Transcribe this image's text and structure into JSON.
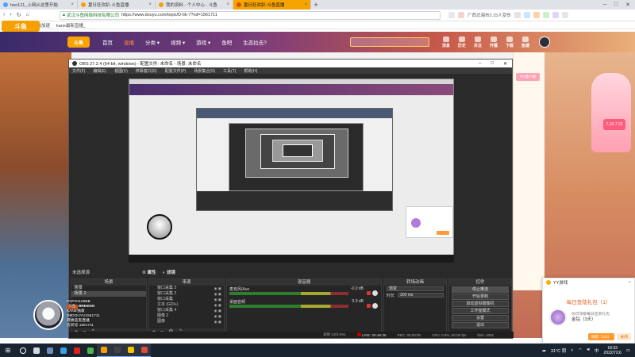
{
  "browser": {
    "tabs": [
      {
        "title": "heo121_上网从这里开始",
        "color": "#4aa0ff",
        "active": false
      },
      {
        "title": "夏日狂欢趴-斗鱼直播",
        "color": "#f5a000",
        "active": false
      },
      {
        "title": "我的资料 - 个人中心 - 斗鱼",
        "color": "#f5a000",
        "active": false
      },
      {
        "title": "夏日狂欢趴-斗鱼直播",
        "color": "#f5a000",
        "active": true
      }
    ],
    "url_site": "武汉斗鱼网络科技有限公司",
    "url": "https://www.douyu.com/topic/D-tik-7?rid=1561711",
    "addr_right_text": "广西北海市2.15人受伤",
    "bookmarks": [
      "谷歌游戏加速",
      "kane最新直播_"
    ],
    "logo_text": "斗鱼"
  },
  "site": {
    "logo": "斗鱼",
    "nav": [
      {
        "label": "首页",
        "on": false
      },
      {
        "label": "直播",
        "on": true
      },
      {
        "label": "分类 ▾",
        "on": false
      },
      {
        "label": "视频 ▾",
        "on": false
      },
      {
        "label": "游戏 ▾",
        "on": false
      },
      {
        "label": "鱼吧",
        "on": false
      },
      {
        "label": "生态拉击?",
        "on": false
      }
    ],
    "tools": [
      "消息",
      "历史",
      "关注",
      "开播",
      "下载",
      "鱼塘"
    ],
    "pink_badge": "PC客户端",
    "ad_label": "7.16-7.22"
  },
  "obs": {
    "title": "OBS 27.2.4 (64-bit, windows) - 配置文件: 未命名 - 场景: 未命名",
    "menu": [
      "文件(F)",
      "编辑(E)",
      "视图(V)",
      "停靠窗口(D)",
      "配置文件(P)",
      "场景集合(S)",
      "工具(T)",
      "帮助(H)"
    ],
    "no_source_selected": "未选择源",
    "props_label": "属性",
    "filters_label": "滤镜",
    "docks": {
      "scenes": {
        "title": "场景",
        "items": [
          "场景",
          "场景 2"
        ]
      },
      "sources": {
        "title": "来源",
        "items": [
          "窗口采集 3",
          "窗口采集 2",
          "窗口采集",
          "文本 (GDI+)",
          "窗口采集 4",
          "图像 2",
          "图像"
        ]
      },
      "mixer": {
        "title": "混音器",
        "channels": [
          {
            "name": "麦克风/Aux",
            "db": "-0.0 dB"
          },
          {
            "name": "桌面音频",
            "db": "0.0 dB"
          }
        ]
      },
      "transitions": {
        "title": "转场动画",
        "type": "渐变",
        "duration_label": "时长",
        "duration": "300 ms"
      },
      "controls": {
        "title": "控件",
        "buttons": [
          "停止推流",
          "开始录制",
          "启动虚拟摄像机",
          "工作室模式",
          "设置",
          "退出"
        ]
      }
    },
    "status": {
      "dropped": "丢帧 12(0.0%)",
      "live": "LIVE: 00:49:39",
      "rec": "REC: 00:00:00",
      "cpu": "CPU: 0.8%, 60.00 fps",
      "kbps": "kb/s: 4001"
    }
  },
  "webcam": {
    "lines": [
      "PSPD1105BB",
      "BREENG",
      "KANE独家",
      "D8DOUYU1561711",
      "荷姨蓝黑直播"
    ],
    "room": "房间号 1561711",
    "tag": "斗鱼"
  },
  "yy": {
    "app": "YY游戏",
    "close": "×",
    "title": "每日登陆礼包（1）",
    "desc": "你可领取每日签到礼包",
    "reward": "金钻（3天）",
    "primary_btn": "领取（1/1）",
    "secondary_btn": "关闭"
  },
  "taskbar": {
    "icons": [
      {
        "name": "search-icon",
        "color": "#ffffff"
      },
      {
        "name": "task-view-icon",
        "color": "#cfd8e3"
      },
      {
        "name": "steam-icon",
        "color": "#6d8fb8"
      },
      {
        "name": "edge-icon",
        "color": "#3aa0e8"
      },
      {
        "name": "netease-icon",
        "color": "#e02020"
      },
      {
        "name": "360-browser-icon",
        "color": "#4cb84c"
      },
      {
        "name": "douyu-icon",
        "color": "#f5a000"
      },
      {
        "name": "obs-icon",
        "color": "#444444"
      },
      {
        "name": "yy-icon",
        "color": "#f5c400"
      },
      {
        "name": "chrome-icon",
        "color": "#e24a3a"
      }
    ],
    "weather": "31°C 阴",
    "time": "18:33",
    "date": "2022/7/16"
  }
}
